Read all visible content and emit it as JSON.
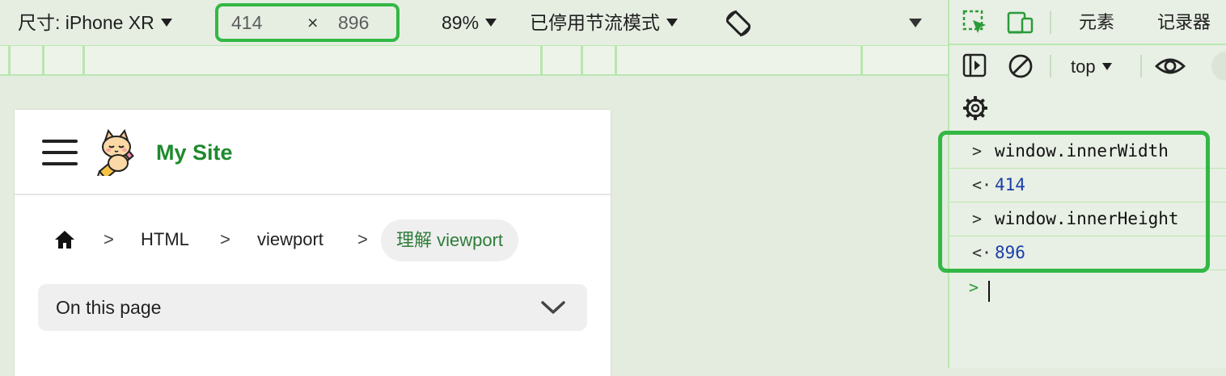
{
  "device_toolbar": {
    "device_label": "尺寸: iPhone XR",
    "width_value": "414",
    "times_sign": "×",
    "height_value": "896",
    "zoom_label": "89%",
    "throttle_label": "已停用节流模式"
  },
  "page": {
    "site_title": "My Site",
    "breadcrumb": {
      "separator": ">",
      "items": [
        "HTML",
        "viewport"
      ],
      "active": "理解 viewport"
    },
    "toc_label": "On this page"
  },
  "devtools": {
    "tabs": [
      "元素",
      "记录器"
    ],
    "context_label": "top",
    "console": [
      {
        "kind": "input",
        "arrow": ">",
        "text": "window.innerWidth"
      },
      {
        "kind": "result",
        "arrow": "<·",
        "text": "414"
      },
      {
        "kind": "input",
        "arrow": ">",
        "text": "window.innerHeight"
      },
      {
        "kind": "result",
        "arrow": "<·",
        "text": "896"
      }
    ],
    "prompt_arrow": ">"
  },
  "colors": {
    "highlight": "#33b845",
    "site_title": "#1e8a2e",
    "console_result": "#1a3fa8"
  }
}
